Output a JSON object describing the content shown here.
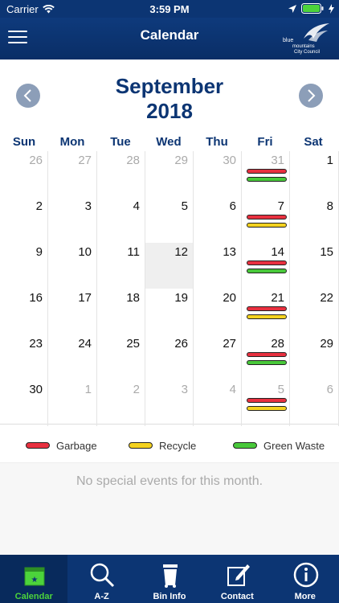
{
  "status": {
    "carrier": "Carrier",
    "time": "3:59 PM"
  },
  "nav": {
    "title": "Calendar",
    "logo_line1": "blue",
    "logo_line2": "mountains",
    "logo_line3": "City Council"
  },
  "calendar": {
    "month": "September",
    "year": "2018",
    "weekdays": [
      "Sun",
      "Mon",
      "Tue",
      "Wed",
      "Thu",
      "Fri",
      "Sat"
    ],
    "weeks": [
      [
        {
          "d": "26",
          "o": true
        },
        {
          "d": "27",
          "o": true
        },
        {
          "d": "28",
          "o": true
        },
        {
          "d": "29",
          "o": true
        },
        {
          "d": "30",
          "o": true
        },
        {
          "d": "31",
          "o": true,
          "bins": [
            "red",
            "green"
          ]
        },
        {
          "d": "1"
        }
      ],
      [
        {
          "d": "2"
        },
        {
          "d": "3"
        },
        {
          "d": "4"
        },
        {
          "d": "5"
        },
        {
          "d": "6"
        },
        {
          "d": "7",
          "bins": [
            "red",
            "yellow"
          ]
        },
        {
          "d": "8"
        }
      ],
      [
        {
          "d": "9"
        },
        {
          "d": "10"
        },
        {
          "d": "11"
        },
        {
          "d": "12",
          "today": true
        },
        {
          "d": "13"
        },
        {
          "d": "14",
          "bins": [
            "red",
            "green"
          ]
        },
        {
          "d": "15"
        }
      ],
      [
        {
          "d": "16"
        },
        {
          "d": "17"
        },
        {
          "d": "18"
        },
        {
          "d": "19"
        },
        {
          "d": "20"
        },
        {
          "d": "21",
          "bins": [
            "red",
            "yellow"
          ]
        },
        {
          "d": "22"
        }
      ],
      [
        {
          "d": "23"
        },
        {
          "d": "24"
        },
        {
          "d": "25"
        },
        {
          "d": "26"
        },
        {
          "d": "27"
        },
        {
          "d": "28",
          "bins": [
            "red",
            "green"
          ]
        },
        {
          "d": "29"
        }
      ],
      [
        {
          "d": "30"
        },
        {
          "d": "1",
          "o": true
        },
        {
          "d": "2",
          "o": true
        },
        {
          "d": "3",
          "o": true
        },
        {
          "d": "4",
          "o": true
        },
        {
          "d": "5",
          "o": true,
          "bins": [
            "red",
            "yellow"
          ]
        },
        {
          "d": "6",
          "o": true
        }
      ]
    ]
  },
  "legend": [
    {
      "label": "Garbage",
      "color": "#e8303f"
    },
    {
      "label": "Recycle",
      "color": "#f4d21f"
    },
    {
      "label": "Green Waste",
      "color": "#48c83a"
    }
  ],
  "events": {
    "message": "No special events for this month."
  },
  "tabs": [
    {
      "label": "Calendar",
      "icon": "calendar-icon",
      "active": true
    },
    {
      "label": "A-Z",
      "icon": "search-icon"
    },
    {
      "label": "Bin Info",
      "icon": "bin-icon"
    },
    {
      "label": "Contact",
      "icon": "edit-icon"
    },
    {
      "label": "More",
      "icon": "info-icon"
    }
  ],
  "colors": {
    "brand": "#0c3573",
    "active_tab": "#4cd33b"
  }
}
